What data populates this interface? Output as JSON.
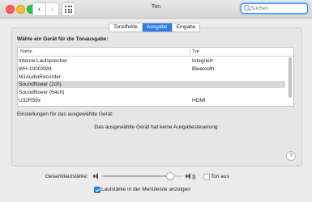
{
  "window": {
    "title": "Ton",
    "search_placeholder": "Suchen"
  },
  "tabs": [
    {
      "label": "Toneffekte",
      "active": false
    },
    {
      "label": "Ausgabe",
      "active": true
    },
    {
      "label": "Eingabe",
      "active": false
    }
  ],
  "output": {
    "heading": "Wähle ein Gerät für die Tonausgabe:",
    "columns": [
      "Name",
      "Typ"
    ],
    "devices": [
      {
        "name": "Interne Lautsprecher",
        "type": "Integriert"
      },
      {
        "name": "WH-1000XM4",
        "type": "Bluetooth"
      },
      {
        "name": "MJAudioRecorder",
        "type": ""
      },
      {
        "name": "Soundflower (2ch)",
        "type": "",
        "selected": true
      },
      {
        "name": "Soundflower (64ch)",
        "type": ""
      },
      {
        "name": "U32R59x",
        "type": "HDMI"
      }
    ],
    "settings_label": "Einstellungen für das ausgewählte Gerät:",
    "no_output_message": "Das ausgewählte Gerät hat keine Ausgabesteuerung"
  },
  "help_label": "?",
  "volume": {
    "label": "Gesamtlautstärke:",
    "level": 0.88,
    "mute_label": "Ton aus",
    "muted": false,
    "menubar_label": "Lautstärke in der Menüleiste anzeigen",
    "menubar_checked": true
  },
  "colors": {
    "accent": "#2f7ce8",
    "selected_row": "#d9d9d9"
  }
}
